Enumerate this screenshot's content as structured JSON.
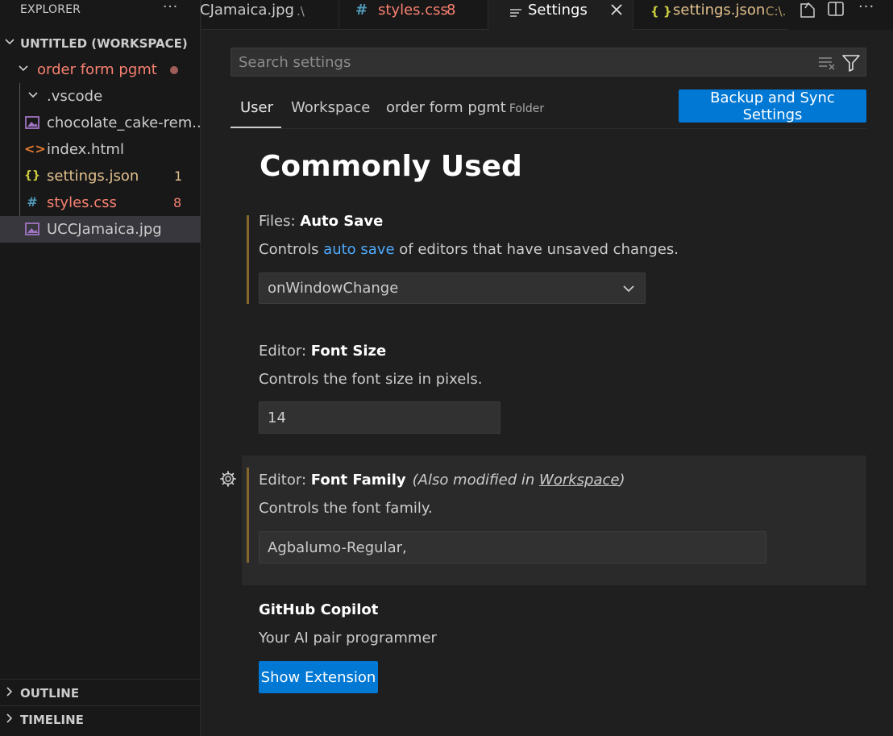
{
  "explorer": {
    "title": "EXPLORER",
    "more": "···",
    "workspace": "UNTITLED (WORKSPACE)",
    "folder": "order form pgmt",
    "items": [
      {
        "label": ".vscode",
        "type": "folder"
      },
      {
        "label": "chocolate_cake-rem...",
        "type": "image"
      },
      {
        "label": "index.html",
        "type": "html"
      },
      {
        "label": "settings.json",
        "type": "json",
        "badge": "1"
      },
      {
        "label": "styles.css",
        "type": "css",
        "badge": "8"
      },
      {
        "label": "UCCJamaica.jpg",
        "type": "image"
      }
    ],
    "outline": "OUTLINE",
    "timeline": "TIMELINE"
  },
  "tabs": [
    {
      "label": "CJamaica.jpg",
      "path": ".\\"
    },
    {
      "label": "styles.css",
      "badge": "8",
      "icon": "#"
    },
    {
      "label": "Settings",
      "active": true
    },
    {
      "label": "settings.json",
      "path": "C:\\.",
      "icon": "{ }"
    }
  ],
  "settings": {
    "search_placeholder": "Search settings",
    "scopes": [
      "User",
      "Workspace",
      "order form pgmt"
    ],
    "folder_tag": "Folder",
    "sync_button": "Backup and Sync Settings",
    "section_title": "Commonly Used",
    "auto_save": {
      "category": "Files:",
      "name": "Auto Save",
      "desc_before": "Controls ",
      "desc_link": "auto save",
      "desc_after": " of editors that have unsaved changes.",
      "value": "onWindowChange"
    },
    "font_size": {
      "category": "Editor:",
      "name": "Font Size",
      "desc": "Controls the font size in pixels.",
      "value": "14"
    },
    "font_family": {
      "category": "Editor:",
      "name": "Font Family",
      "modified_before": "(Also modified in ",
      "modified_link": "Workspace",
      "modified_after": ")",
      "desc": "Controls the font family.",
      "value": "Agbalumo-Regular,"
    },
    "copilot": {
      "name": "GitHub Copilot",
      "desc": "Your AI pair programmer",
      "button": "Show Extension"
    }
  },
  "colors": {
    "accent": "#0078d4",
    "modified_bar": "#85672f",
    "json_yellow": "#e2c08d",
    "css_red": "#f14c4c"
  }
}
